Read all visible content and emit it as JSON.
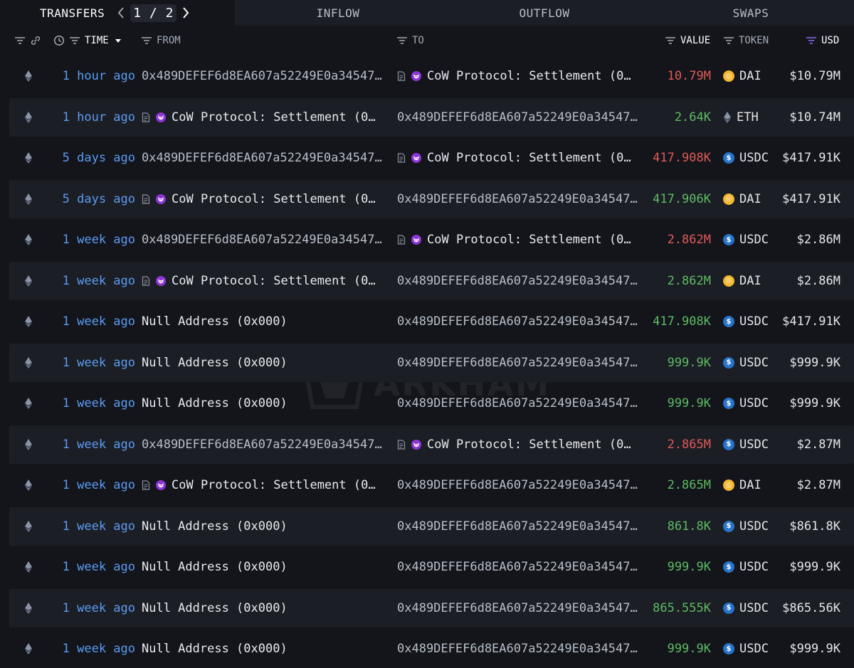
{
  "colors": {
    "background": "#13151b",
    "row_alt": "#1c1e25",
    "time_link": "#5b9cf2",
    "value_out": "#e05a56",
    "value_in": "#5dbb63",
    "cow_badge": "#8e35d6",
    "dai": "#f4b731",
    "usdc": "#2775ca"
  },
  "tabs": {
    "transfers": "TRANSFERS",
    "page_current": "1",
    "page_sep": "/",
    "page_total": "2",
    "inflow": "INFLOW",
    "outflow": "OUTFLOW",
    "swaps": "SWAPS"
  },
  "header": {
    "time": "TIME",
    "from": "FROM",
    "to": "TO",
    "value": "VALUE",
    "token": "TOKEN",
    "usd": "USD"
  },
  "watermark": {
    "text": "ARKHAM"
  },
  "rows": [
    {
      "time": "1 hour ago",
      "from": "0x489DEFEF6d8EA607a52249E0a34547…",
      "from_type": "addr",
      "to": "CoW Protocol: Settlement (0…",
      "to_type": "cow",
      "value": "10.79M",
      "direction": "out",
      "token": "DAI",
      "token_icon": "dai-icon",
      "usd": "$10.79M"
    },
    {
      "time": "1 hour ago",
      "from": "CoW Protocol: Settlement (0…",
      "from_type": "cow",
      "to": "0x489DEFEF6d8EA607a52249E0a34547…",
      "to_type": "addr",
      "value": "2.64K",
      "direction": "in",
      "token": "ETH",
      "token_icon": "ethereum-icon",
      "usd": "$10.74M"
    },
    {
      "time": "5 days ago",
      "from": "0x489DEFEF6d8EA607a52249E0a34547…",
      "from_type": "addr",
      "to": "CoW Protocol: Settlement (0…",
      "to_type": "cow",
      "value": "417.908K",
      "direction": "out",
      "token": "USDC",
      "token_icon": "usdc-icon",
      "usd": "$417.91K"
    },
    {
      "time": "5 days ago",
      "from": "CoW Protocol: Settlement (0…",
      "from_type": "cow",
      "to": "0x489DEFEF6d8EA607a52249E0a34547…",
      "to_type": "addr",
      "value": "417.906K",
      "direction": "in",
      "token": "DAI",
      "token_icon": "dai-icon",
      "usd": "$417.91K"
    },
    {
      "time": "1 week ago",
      "from": "0x489DEFEF6d8EA607a52249E0a34547…",
      "from_type": "addr",
      "to": "CoW Protocol: Settlement (0…",
      "to_type": "cow",
      "value": "2.862M",
      "direction": "out",
      "token": "USDC",
      "token_icon": "usdc-icon",
      "usd": "$2.86M"
    },
    {
      "time": "1 week ago",
      "from": "CoW Protocol: Settlement (0…",
      "from_type": "cow",
      "to": "0x489DEFEF6d8EA607a52249E0a34547…",
      "to_type": "addr",
      "value": "2.862M",
      "direction": "in",
      "token": "DAI",
      "token_icon": "dai-icon",
      "usd": "$2.86M"
    },
    {
      "time": "1 week ago",
      "from": "Null Address (0x000)",
      "from_type": "plain",
      "to": "0x489DEFEF6d8EA607a52249E0a34547…",
      "to_type": "addr",
      "value": "417.908K",
      "direction": "in",
      "token": "USDC",
      "token_icon": "usdc-icon",
      "usd": "$417.91K"
    },
    {
      "time": "1 week ago",
      "from": "Null Address (0x000)",
      "from_type": "plain",
      "to": "0x489DEFEF6d8EA607a52249E0a34547…",
      "to_type": "addr",
      "value": "999.9K",
      "direction": "in",
      "token": "USDC",
      "token_icon": "usdc-icon",
      "usd": "$999.9K"
    },
    {
      "time": "1 week ago",
      "from": "Null Address (0x000)",
      "from_type": "plain",
      "to": "0x489DEFEF6d8EA607a52249E0a34547…",
      "to_type": "addr",
      "value": "999.9K",
      "direction": "in",
      "token": "USDC",
      "token_icon": "usdc-icon",
      "usd": "$999.9K"
    },
    {
      "time": "1 week ago",
      "from": "0x489DEFEF6d8EA607a52249E0a34547…",
      "from_type": "addr",
      "to": "CoW Protocol: Settlement (0…",
      "to_type": "cow",
      "value": "2.865M",
      "direction": "out",
      "token": "USDC",
      "token_icon": "usdc-icon",
      "usd": "$2.87M"
    },
    {
      "time": "1 week ago",
      "from": "CoW Protocol: Settlement (0…",
      "from_type": "cow",
      "to": "0x489DEFEF6d8EA607a52249E0a34547…",
      "to_type": "addr",
      "value": "2.865M",
      "direction": "in",
      "token": "DAI",
      "token_icon": "dai-icon",
      "usd": "$2.87M"
    },
    {
      "time": "1 week ago",
      "from": "Null Address (0x000)",
      "from_type": "plain",
      "to": "0x489DEFEF6d8EA607a52249E0a34547…",
      "to_type": "addr",
      "value": "861.8K",
      "direction": "in",
      "token": "USDC",
      "token_icon": "usdc-icon",
      "usd": "$861.8K"
    },
    {
      "time": "1 week ago",
      "from": "Null Address (0x000)",
      "from_type": "plain",
      "to": "0x489DEFEF6d8EA607a52249E0a34547…",
      "to_type": "addr",
      "value": "999.9K",
      "direction": "in",
      "token": "USDC",
      "token_icon": "usdc-icon",
      "usd": "$999.9K"
    },
    {
      "time": "1 week ago",
      "from": "Null Address (0x000)",
      "from_type": "plain",
      "to": "0x489DEFEF6d8EA607a52249E0a34547…",
      "to_type": "addr",
      "value": "865.555K",
      "direction": "in",
      "token": "USDC",
      "token_icon": "usdc-icon",
      "usd": "$865.56K"
    },
    {
      "time": "1 week ago",
      "from": "Null Address (0x000)",
      "from_type": "plain",
      "to": "0x489DEFEF6d8EA607a52249E0a34547…",
      "to_type": "addr",
      "value": "999.9K",
      "direction": "in",
      "token": "USDC",
      "token_icon": "usdc-icon",
      "usd": "$999.9K"
    }
  ]
}
